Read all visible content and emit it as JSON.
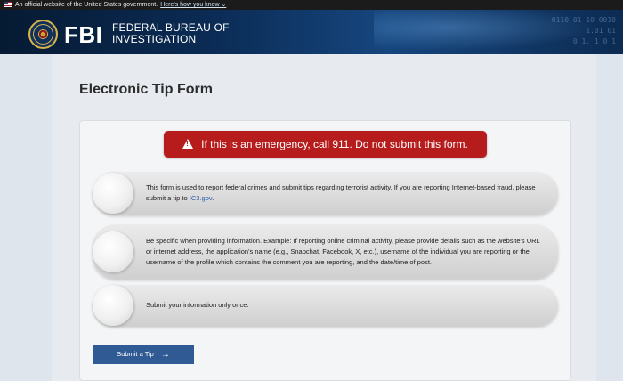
{
  "gov_banner": {
    "text": "An official website of the United States government.",
    "link": "Here's how you know",
    "chevron": "⌄"
  },
  "header": {
    "logo": "FBI",
    "agency_line1": "FEDERAL BUREAU OF",
    "agency_line2": "INVESTIGATION",
    "binary_lines": [
      "0110 01 10 0010",
      "1.01 01",
      "0 1. 1 0 1"
    ]
  },
  "page": {
    "title": "Electronic Tip Form"
  },
  "alert": {
    "text": "If this is an emergency, call 911. Do not submit this form.",
    "icon": "warning-icon",
    "color": "#b71c1c"
  },
  "notices": [
    {
      "text": "This form is used to report federal crimes and submit tips regarding terrorist activity. If you are reporting Internet-based fraud, please submit a tip to ",
      "link": "IC3.gov",
      "suffix": "."
    },
    {
      "text": "Be specific when providing information. Example: If reporting online criminal activity, please provide details such as the website's URL or internet address, the application's name (e.g., Snapchat, Facebook, X, etc.), username of the individual you are reporting or the username of the profile which contains the comment you are reporting, and the date/time of post."
    },
    {
      "text": "Submit your information only once."
    }
  ],
  "submit": {
    "label": "Submit a Tip",
    "arrow": "→",
    "color": "#2f5a93"
  }
}
